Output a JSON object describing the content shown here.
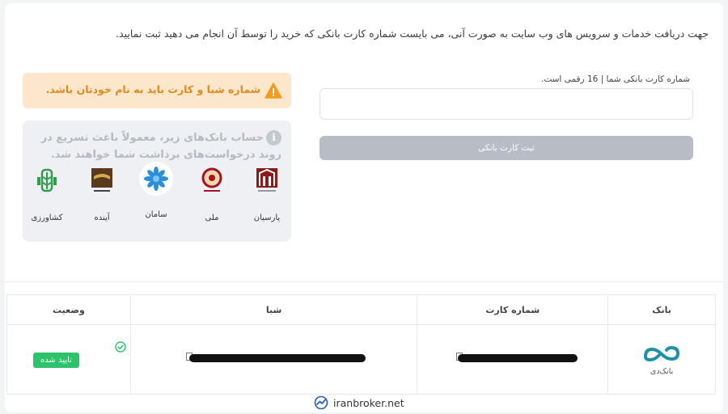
{
  "intro_text": "جهت دریافت خدمات و سرویس های وب سایت به صورت آنی، می بایست شماره کارت بانکی که خرید را توسط آن انجام می دهید ثبت نمایید.",
  "form": {
    "card_label": "شماره کارت بانکی شما | 16 رقمی است.",
    "card_value": "",
    "submit_label": "ثبت کارت بانکی"
  },
  "warning": {
    "text": "شماره شبا و کارت باید به نام خودتان باشد.",
    "color": "#e08a1c"
  },
  "info": {
    "text": "حساب بانک‌های زیر، معمولاً باعث تسریع در روند درخواست‌های برداشت شما خواهند شد.",
    "banks": [
      {
        "name": "پارسیان",
        "icon": "parsian-logo"
      },
      {
        "name": "ملی",
        "icon": "melli-logo"
      },
      {
        "name": "سامان",
        "icon": "saman-logo"
      },
      {
        "name": "آینده",
        "icon": "ayandeh-logo"
      },
      {
        "name": "کشاورزی",
        "icon": "keshavarzi-logo"
      }
    ]
  },
  "table": {
    "headers": {
      "bank": "بانک",
      "card": "شماره کارت",
      "sheba": "شبا",
      "status": "وضعیت"
    },
    "rows": [
      {
        "bank_name": "بانک‌دی",
        "status": "تایید شده",
        "status_color": "#2cc36b"
      }
    ]
  },
  "watermark": "iranbroker.net"
}
